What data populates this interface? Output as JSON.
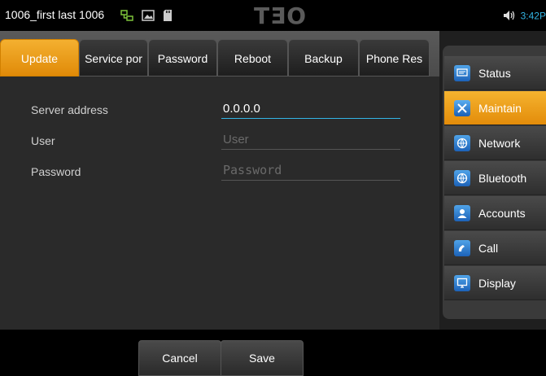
{
  "status_bar": {
    "title": "1006_first last 1006",
    "logo": "TƎO",
    "time": "3:42",
    "time_suffix": "P",
    "icons": [
      "network-icon",
      "image-icon",
      "sdcard-icon",
      "volume-icon"
    ]
  },
  "tabs": [
    {
      "label": "Update",
      "active": true
    },
    {
      "label": "Service por",
      "active": false
    },
    {
      "label": "Password",
      "active": false
    },
    {
      "label": "Reboot",
      "active": false
    },
    {
      "label": "Backup",
      "active": false
    },
    {
      "label": "Phone Res",
      "active": false
    }
  ],
  "form": {
    "server": {
      "label": "Server address",
      "value": "0.0.0.0"
    },
    "user": {
      "label": "User",
      "value": "",
      "placeholder": "User"
    },
    "password": {
      "label": "Password",
      "value": "",
      "placeholder": "Password"
    }
  },
  "buttons": {
    "cancel": "Cancel",
    "save": "Save"
  },
  "sidebar": {
    "items": [
      {
        "label": "Status",
        "icon": "status-icon",
        "active": false
      },
      {
        "label": "Maintain",
        "icon": "tools-icon",
        "active": true
      },
      {
        "label": "Network",
        "icon": "network-globe-icon",
        "active": false
      },
      {
        "label": "Bluetooth",
        "icon": "bluetooth-globe-icon",
        "active": false
      },
      {
        "label": "Accounts",
        "icon": "accounts-icon",
        "active": false
      },
      {
        "label": "Call",
        "icon": "call-icon",
        "active": false
      },
      {
        "label": "Display",
        "icon": "display-icon",
        "active": false
      }
    ]
  },
  "colors": {
    "accent": "#f0a020",
    "focus": "#33b5e5"
  }
}
